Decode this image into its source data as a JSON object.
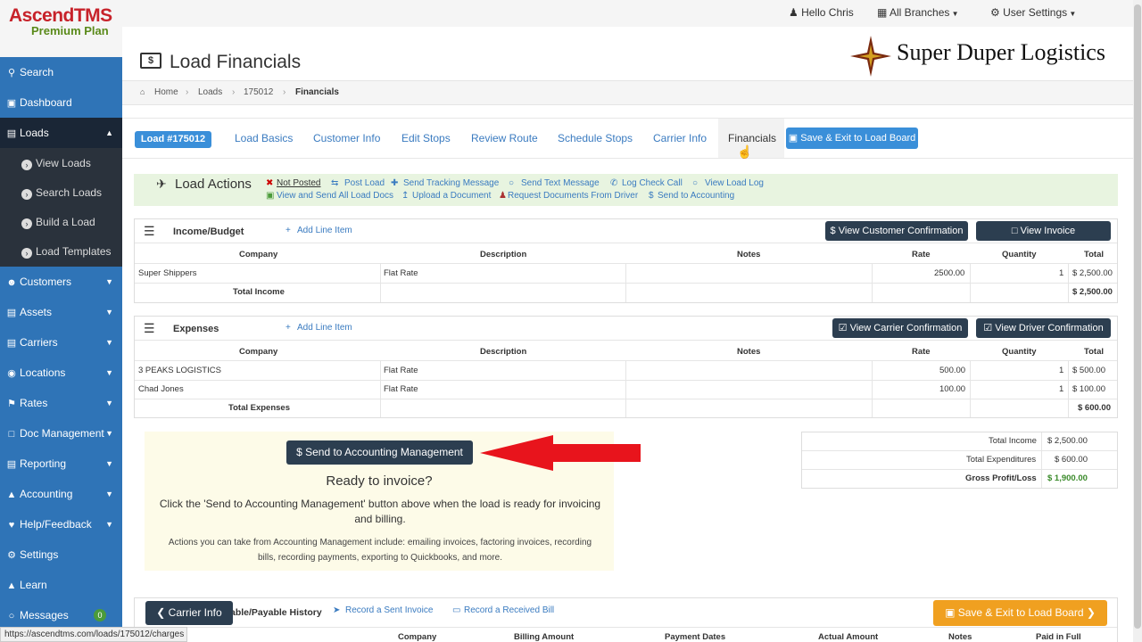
{
  "brand": {
    "name": "AscendTMS",
    "plan": "Premium Plan"
  },
  "sidebar": {
    "items": [
      {
        "label": "Search",
        "icon": "search-icon"
      },
      {
        "label": "Dashboard",
        "icon": "dashboard-icon"
      },
      {
        "label": "Loads",
        "icon": "truck-icon"
      },
      {
        "label": "Customers",
        "icon": "users-icon"
      },
      {
        "label": "Assets",
        "icon": "assets-icon"
      },
      {
        "label": "Carriers",
        "icon": "truck-icon"
      },
      {
        "label": "Locations",
        "icon": "map-pin-icon"
      },
      {
        "label": "Rates",
        "icon": "tag-icon"
      },
      {
        "label": "Doc Management",
        "icon": "file-icon"
      },
      {
        "label": "Reporting",
        "icon": "book-icon"
      },
      {
        "label": "Accounting",
        "icon": "bank-icon"
      },
      {
        "label": "Help/Feedback",
        "icon": "help-icon"
      },
      {
        "label": "Settings",
        "icon": "gear-icon"
      },
      {
        "label": "Learn",
        "icon": "graduation-icon"
      },
      {
        "label": "Messages",
        "icon": "chat-icon",
        "badge": "0"
      }
    ],
    "subitems": [
      "View Loads",
      "Search Loads",
      "Build a Load",
      "Load Templates"
    ]
  },
  "topbar": {
    "user": "Hello Chris",
    "branches": "All Branches",
    "settings": "User Settings"
  },
  "page": {
    "title": "Load Financials",
    "logo_text": "Super Duper Logistics"
  },
  "breadcrumb": [
    "Home",
    "Loads",
    "175012",
    "Financials"
  ],
  "tabs": {
    "badge": "Load #175012",
    "items": [
      "Load Basics",
      "Customer Info",
      "Edit Stops",
      "Review Route",
      "Schedule Stops",
      "Carrier Info",
      "Financials"
    ],
    "save": "Save & Exit to Load Board"
  },
  "actions": {
    "title": "Load Actions",
    "row1": [
      "Not Posted",
      "Post Load",
      "Send Tracking Message",
      "Send Text Message",
      "Log Check Call",
      "View Load Log"
    ],
    "row2": [
      "View and Send All Load Docs",
      "Upload a Document",
      "Request Documents From Driver",
      "Send to Accounting"
    ]
  },
  "income": {
    "title": "Income/Budget",
    "add": "Add Line Item",
    "btn1": "View Customer Confirmation",
    "btn2": "View Invoice",
    "headers": [
      "Company",
      "Description",
      "Notes",
      "Rate",
      "Quantity",
      "Total"
    ],
    "rows": [
      [
        "Super Shippers",
        "Flat Rate",
        "",
        "2500.00",
        "1",
        "$ 2,500.00"
      ]
    ],
    "total_label": "Total Income",
    "total": "$ 2,500.00"
  },
  "expenses": {
    "title": "Expenses",
    "add": "Add Line Item",
    "btn1": "View Carrier Confirmation",
    "btn2": "View Driver Confirmation",
    "headers": [
      "Company",
      "Description",
      "Notes",
      "Rate",
      "Quantity",
      "Total"
    ],
    "rows": [
      [
        "3 PEAKS LOGISTICS",
        "Flat Rate",
        "",
        "500.00",
        "1",
        "$ 500.00"
      ],
      [
        "Chad Jones",
        "Flat Rate",
        "",
        "100.00",
        "1",
        "$ 100.00"
      ]
    ],
    "total_label": "Total Expenses",
    "total": "$ 600.00"
  },
  "accounting": {
    "button": "$ Send to Accounting Management",
    "heading": "Ready to invoice?",
    "text": "Click the 'Send to Accounting Management' button above when the load is ready for invoicing and billing.",
    "note": "Actions you can take from Accounting Management include: emailing invoices, factoring invoices, recording bills, recording payments, exporting to Quickbooks, and more."
  },
  "summary": {
    "rows": [
      {
        "label": "Total Income",
        "value": "$ 2,500.00"
      },
      {
        "label": "Total Expenditures",
        "value": "$ 600.00"
      },
      {
        "label": "Gross Profit/Loss",
        "value": "$ 1,900.00"
      }
    ]
  },
  "history": {
    "title": "able/Payable History",
    "link1": "Record a Sent Invoice",
    "link2": "Record a Received Bill",
    "headers": [
      "Company",
      "Billing Amount",
      "Payment Dates",
      "Actual Amount",
      "Notes",
      "Paid in Full"
    ]
  },
  "floating": {
    "carrier_info": "Carrier Info",
    "save_exit": "Save & Exit to Load Board"
  },
  "status_url": "https://ascendtms.com/loads/175012/charges",
  "colors": {
    "sidebar": "#2f74b7",
    "accent_blue": "#3a8fd9",
    "dark_button": "#2c3e50",
    "orange": "#f0a020",
    "arrow": "#e8141c"
  }
}
